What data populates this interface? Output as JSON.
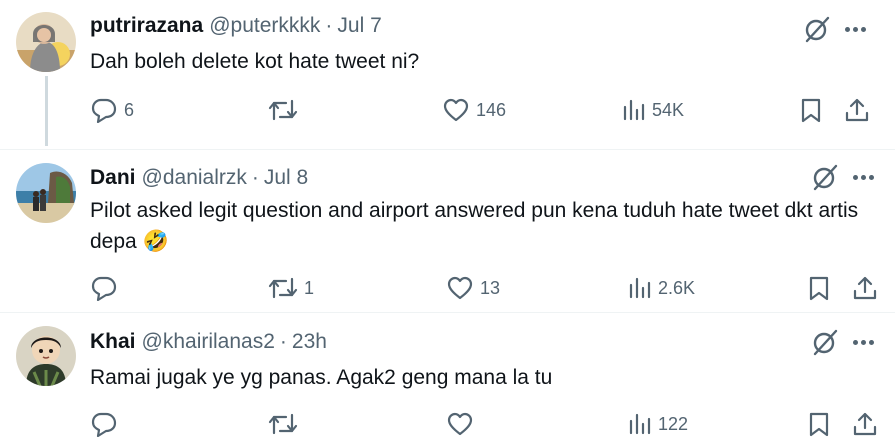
{
  "tweets": [
    {
      "name": "putrirazana",
      "handle": "@puterkkkk",
      "separator": "·",
      "date": "Jul 7",
      "text": "Dah boleh delete kot hate tweet ni?",
      "replies": "6",
      "reposts": "",
      "likes": "146",
      "views": "54K"
    },
    {
      "name": "Dani",
      "handle": "@danialrzk",
      "separator": "·",
      "date": "Jul 8",
      "text": "Pilot asked legit question and airport answered pun kena tuduh hate tweet dkt artis depa 🤣",
      "replies": "",
      "reposts": "1",
      "likes": "13",
      "views": "2.6K"
    },
    {
      "name": "Khai",
      "handle": "@khairilanas2",
      "separator": "·",
      "date": "23h",
      "text": "Ramai jugak ye yg panas. Agak2 geng mana la tu",
      "replies": "",
      "reposts": "",
      "likes": "",
      "views": "122"
    }
  ],
  "colors": {
    "text": "#0f1419",
    "secondary": "#536471",
    "thread_line": "#cfd9de"
  },
  "icons": [
    "reply-icon",
    "repost-icon",
    "like-icon",
    "views-icon",
    "bookmark-icon",
    "share-icon",
    "grok-icon",
    "more-icon"
  ]
}
